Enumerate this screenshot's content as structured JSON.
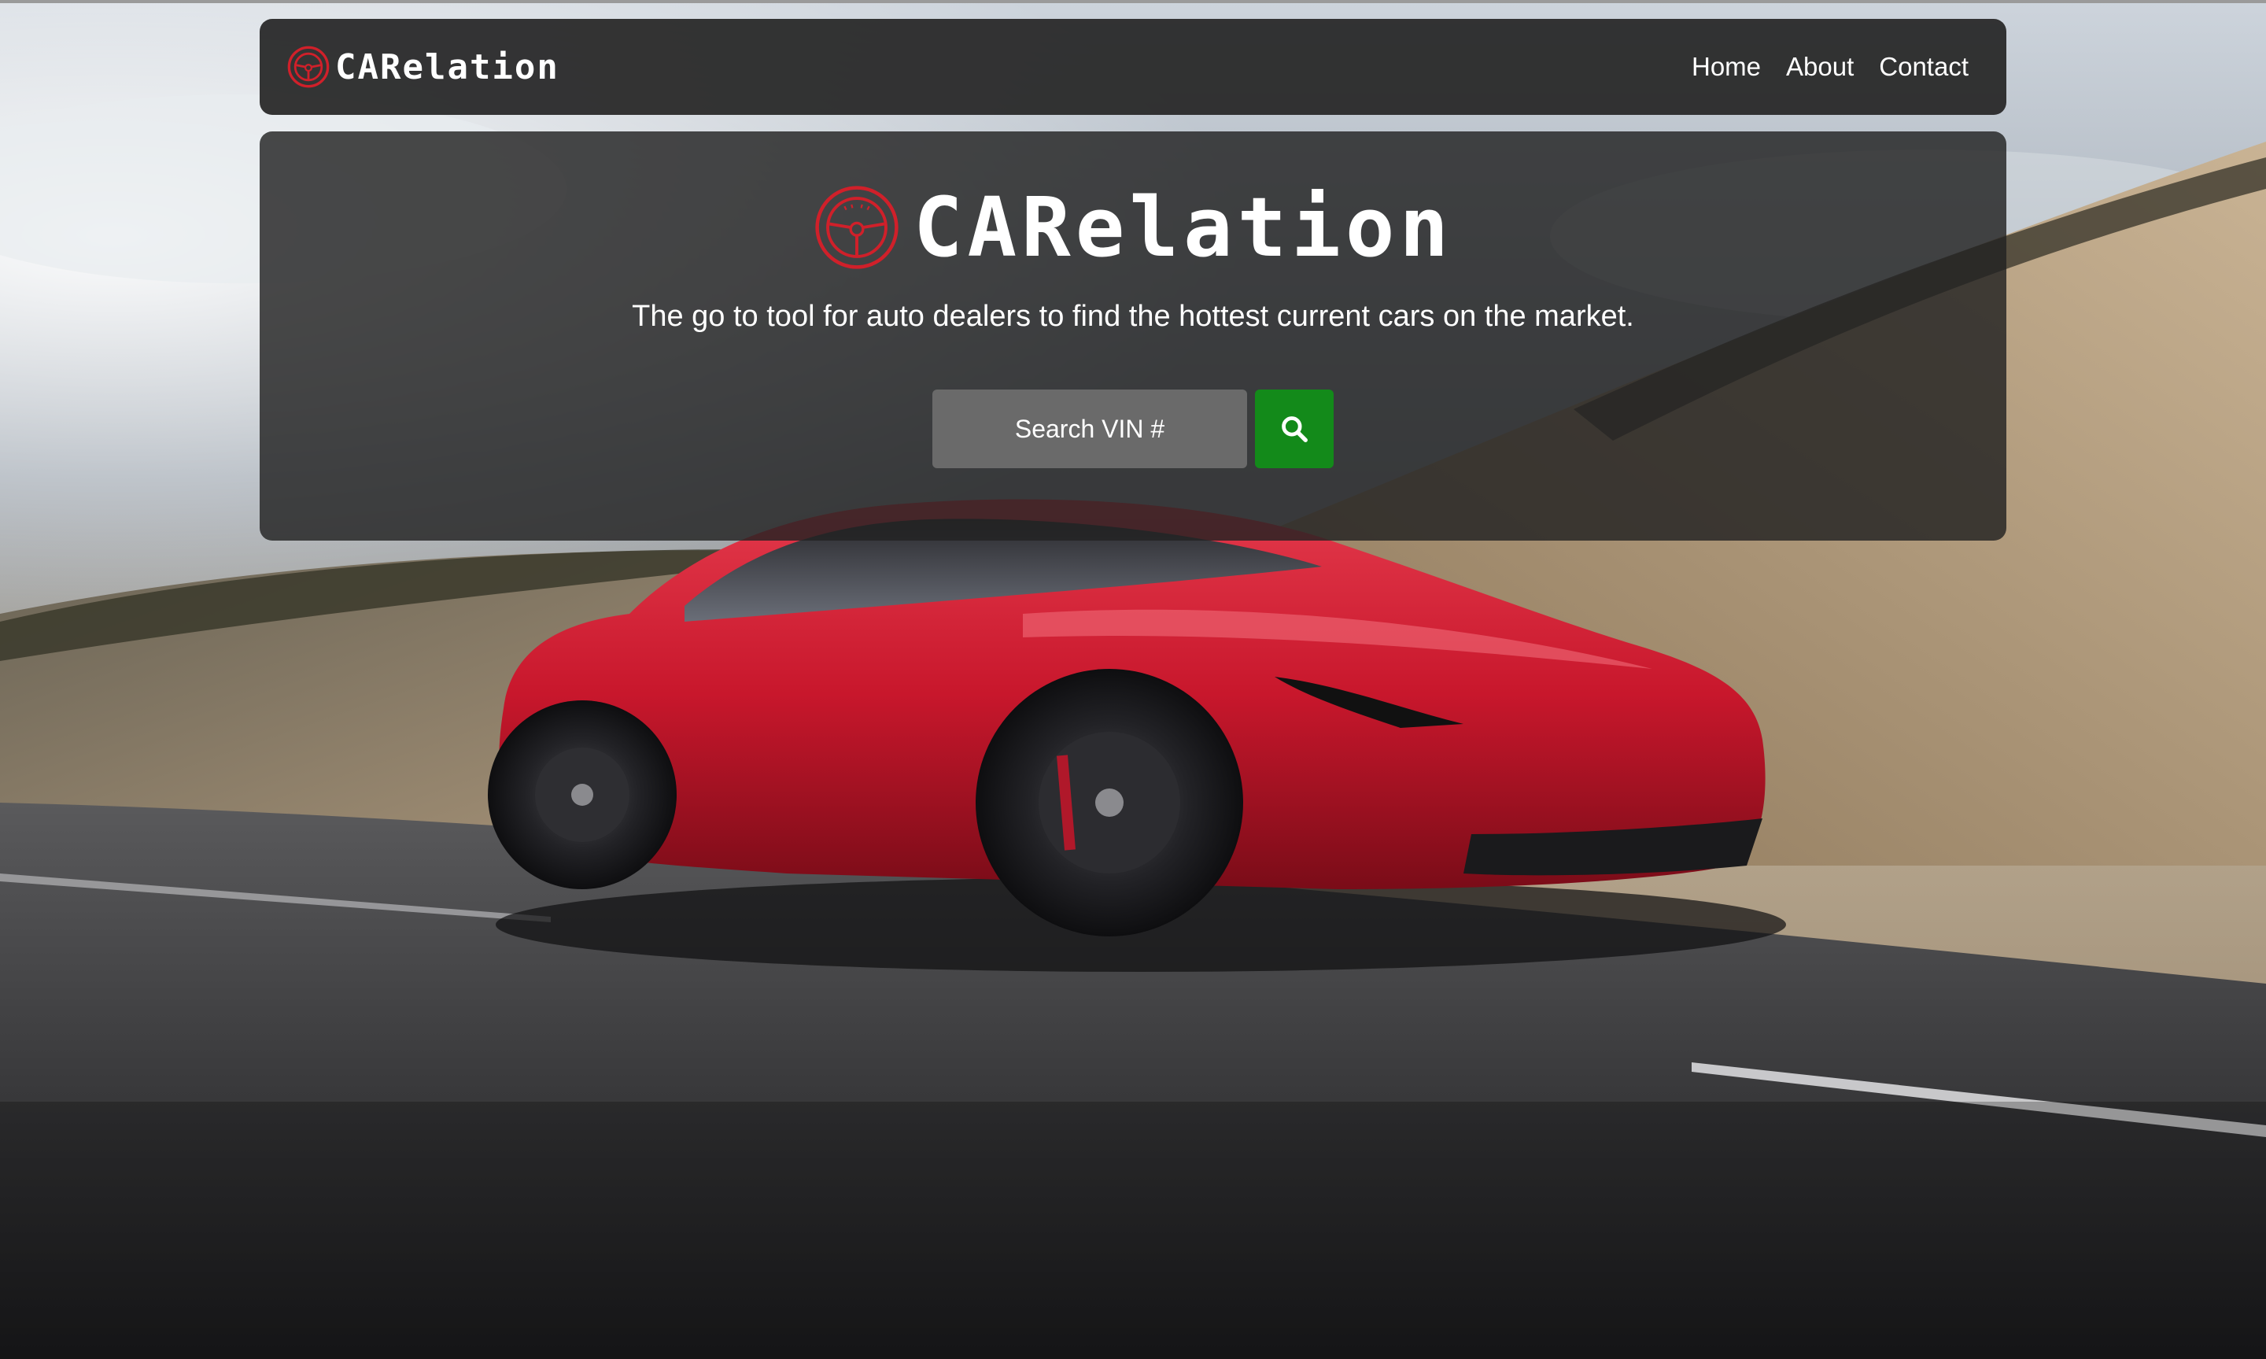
{
  "navbar": {
    "brand": "CARelation",
    "links": [
      "Home",
      "About",
      "Contact"
    ]
  },
  "hero": {
    "title": "CARelation",
    "tagline": "The go to tool for auto dealers to find the hottest current cars on the market.",
    "search": {
      "placeholder": "Search VIN #",
      "value": "",
      "button_icon": "search-icon"
    }
  },
  "icons": {
    "logo": "steering-wheel-icon",
    "search": "magnifier-icon"
  },
  "colors": {
    "brand_red": "#d0202a",
    "search_button": "#138a1a",
    "navbar_bg": "#262626",
    "car_red": "#c8172c"
  }
}
